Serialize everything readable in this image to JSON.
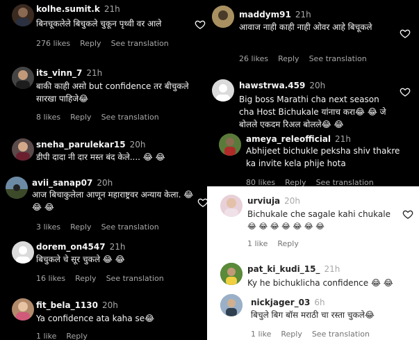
{
  "left": [
    {
      "user": "kolhe.sumit.k",
      "time": "21h",
      "text": "बिनचूकलेले बिचुकले चुकून पृथ्वी वर आले",
      "likes": "276 likes",
      "reply": "Reply",
      "translate": "See translation"
    },
    {
      "user": "its_vinn_7",
      "time": "21h",
      "text": "बाकी काही असो but confidence तर बीचुकले सारखा पाहिजे😂",
      "likes": "8 likes",
      "reply": "Reply",
      "translate": "See translation"
    },
    {
      "user": "sneha_parulekar15",
      "time": "20h",
      "text": "डीपी दादा नी दार मस्त बंद केले.... 😂 😂",
      "likes": "",
      "reply": "",
      "translate": ""
    },
    {
      "user": "avii_sanap07",
      "time": "20h",
      "text": "आज बिचाकुलेला आणून महाराष्ट्रवर अन्याय केला. 😂 😂 😂",
      "likes": "3 likes",
      "reply": "Reply",
      "translate": "See translation"
    },
    {
      "user": "dorem_on4547",
      "time": "21h",
      "text": "बिचुकले चे सूर चुकले 😂 😂",
      "likes": "16 likes",
      "reply": "Reply",
      "translate": "See translation"
    },
    {
      "user": "fit_bela_1130",
      "time": "20h",
      "text": "Ya confidence ata kaha se😂",
      "likes": "1 like",
      "reply": "Reply",
      "translate": ""
    }
  ],
  "right": [
    {
      "user": "maddym91",
      "time": "21h",
      "text": "आवाज नाही काही नाही ओवर आहे बिचूकले",
      "likes": "26 likes",
      "reply": "Reply",
      "translate": "See translation"
    },
    {
      "user": "hawstrwa.459",
      "time": "20h",
      "text": "Big boss Marathi cha next season cha Host Bichukale यांनाच करा😂 😂 जे बोलले एकदम रिअल बोलले😂 😂",
      "likes": "",
      "reply": "",
      "translate": ""
    },
    {
      "user": "ameya_releofficial",
      "time": "21h",
      "text": "Abhijeet bichukle peksha shiv thakre ka invite kela phije hota",
      "likes": "80 likes",
      "reply": "Reply",
      "translate": "See translation"
    }
  ],
  "right_light": [
    {
      "user": "urviuja",
      "time": "20h",
      "text": "Bichukale che sagale kahi chukale",
      "emoji": "😂 😂 😂 😂 😂 😂 😂",
      "likes": "1 like",
      "reply": "Reply"
    },
    {
      "user": "pat_ki_kudi_15_",
      "time": "21h",
      "text": "Ky he bichuklicha confidence 😂 😂",
      "likes": "",
      "reply": ""
    },
    {
      "user": "nickjager_03",
      "time": "6h",
      "text": "बिचुले बिग बॉस मराठी चा रस्ता चुकले😂",
      "likes": "1 like",
      "reply": "Reply",
      "translate": "See translation"
    }
  ]
}
